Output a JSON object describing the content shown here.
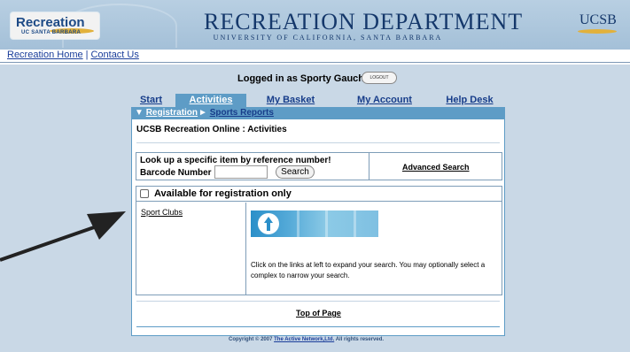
{
  "header": {
    "logo_main": "Recreation",
    "logo_sub": "UC SANTA BARBARA",
    "title": "RECREATION DEPARTMENT",
    "subtitle": "UNIVERSITY OF CALIFORNIA, SANTA BARBARA",
    "ucsb": "UCSB",
    "brand_color": "#15386b",
    "accent_color": "#e2b13b"
  },
  "topnav": {
    "home": "Recreation Home",
    "separator": "|",
    "contact": "Contact Us"
  },
  "login": {
    "text": "Logged in as  Sporty Gaucho",
    "logout_label": "LOGOUT"
  },
  "tabs": [
    "Start",
    "Activities",
    "My Basket",
    "My Account",
    "Help Desk"
  ],
  "active_tab": "Activities",
  "subnav": {
    "registration": "Registration",
    "sports_reports": "Sports Reports"
  },
  "panel": {
    "title": "UCSB Recreation Online : Activities",
    "lookup_line1": "Look up a specific item by reference number!",
    "barcode_label": "Barcode Number",
    "barcode_value": "",
    "search_label": "Search",
    "advanced_search": "Advanced Search",
    "available_label": "Available for registration only",
    "available_checked": false,
    "left_items": [
      "Sport Clubs"
    ],
    "info_text": "Click on the links at left to expand your search. You may optionally select a complex to narrow your search.",
    "top_of_page": "Top of Page"
  },
  "footer": {
    "copyright_prefix": "Copyright © 2007",
    "company": "The Active Network,Ltd.",
    "suffix": "All rights reserved."
  },
  "colors": {
    "tab_active_bg": "#5e9cc6",
    "page_bg": "#c9d8e6",
    "header_bg": "#a4c0d8"
  }
}
